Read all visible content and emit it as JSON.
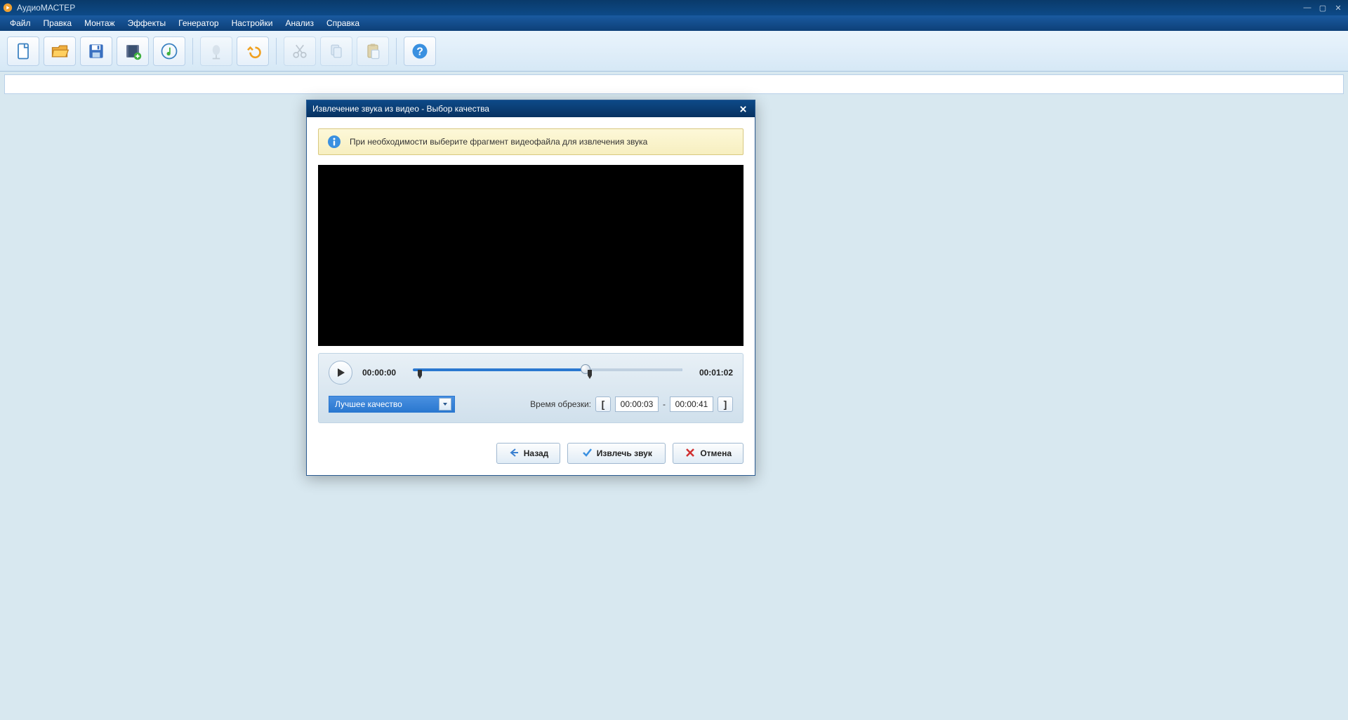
{
  "app_title": "АудиоМАСТЕР",
  "menu": {
    "file": "Файл",
    "edit": "Правка",
    "montage": "Монтаж",
    "effects": "Эффекты",
    "generator": "Генератор",
    "settings": "Настройки",
    "analysis": "Анализ",
    "help": "Справка"
  },
  "dialog": {
    "title": "Извлечение звука из видео - Выбор качества",
    "info": "При необходимости выберите фрагмент видеофайла для извлечения звука",
    "time_current": "00:00:00",
    "time_total": "00:01:02",
    "quality_selected": "Лучшее качество",
    "trim_label": "Время обрезки:",
    "trim_start": "00:00:03",
    "trim_dash": "-",
    "trim_end": "00:00:41",
    "btn_back": "Назад",
    "btn_extract": "Извлечь звук",
    "btn_cancel": "Отмена"
  },
  "seek": {
    "progress_pct": 64,
    "trim_start_pct": 3,
    "trim_end_pct": 65
  }
}
